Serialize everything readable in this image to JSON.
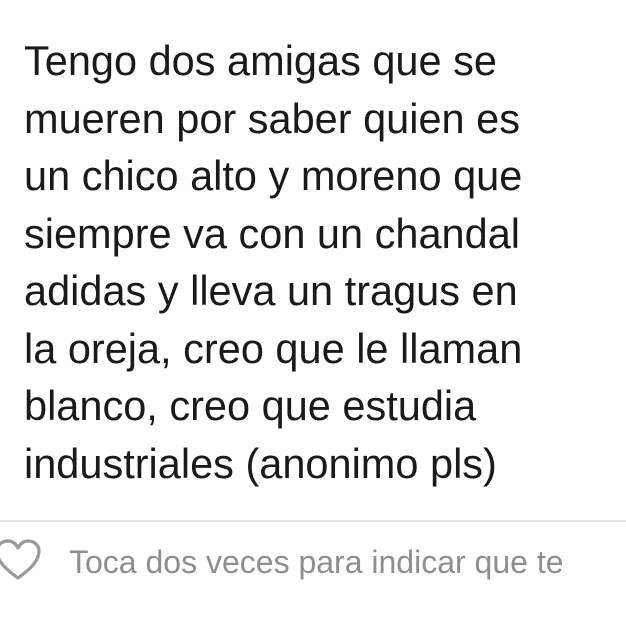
{
  "message": {
    "text": "Tengo dos amigas que se\nmueren por saber quien es\nun chico alto y moreno que\nsiempre va con un chandal\nadidas y lleva un tragus en\nla oreja, creo que le llaman\nblanco, creo que estudia\nindustriales (anonimo pls)"
  },
  "footer": {
    "like_icon": "heart-outline-icon",
    "hint": "Toca dos veces para indicar que te"
  },
  "colors": {
    "text": "#1a1a1a",
    "hint": "#8e8e8e",
    "bubble_border": "#e6e6e6",
    "icon": "#9a9a9a"
  }
}
